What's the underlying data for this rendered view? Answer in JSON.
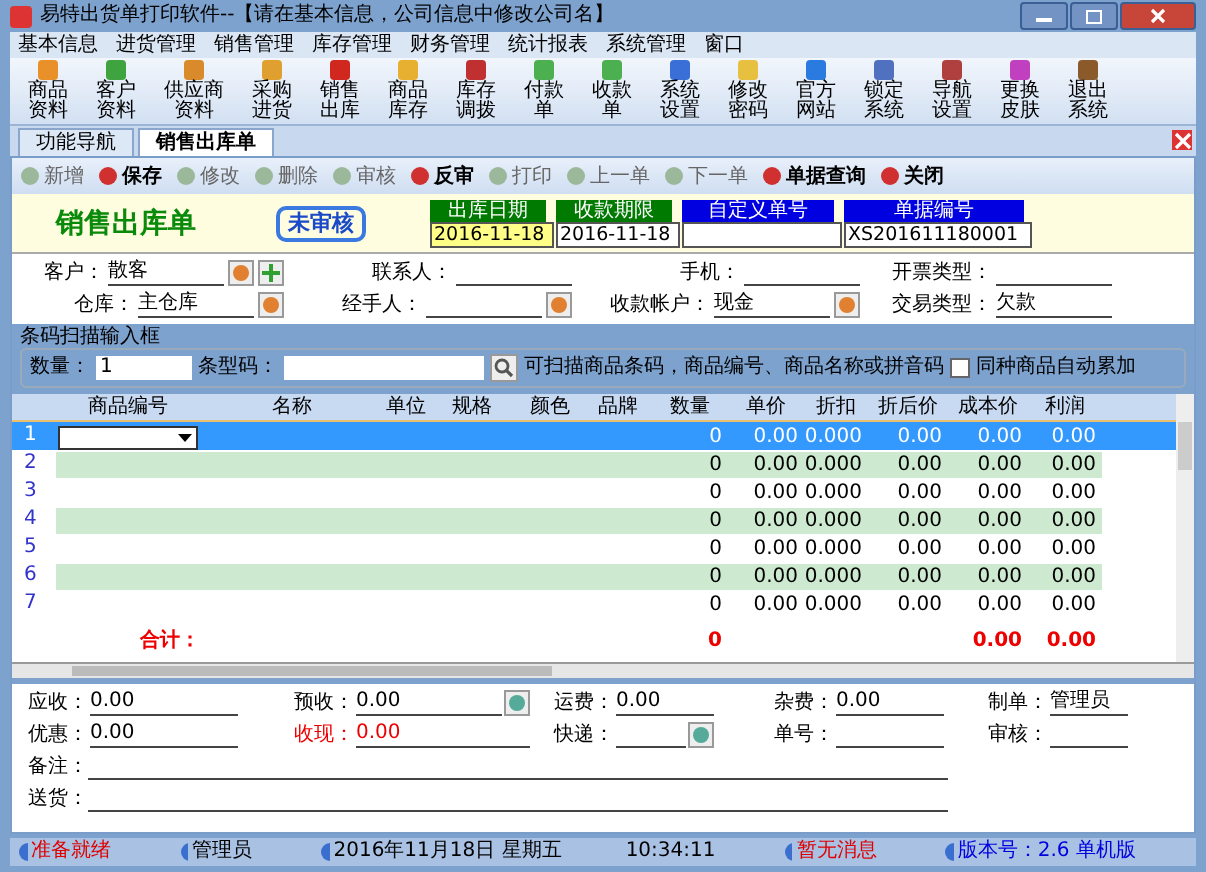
{
  "window": {
    "title": "易特出货单打印软件--【请在基本信息，公司信息中修改公司名】"
  },
  "menu": [
    "基本信息",
    "进货管理",
    "销售管理",
    "库存管理",
    "财务管理",
    "统计报表",
    "系统管理",
    "窗口"
  ],
  "toolbar": [
    {
      "label": "商品资料",
      "color": "#e8902a"
    },
    {
      "label": "客户资料",
      "color": "#3fa33f"
    },
    {
      "label": "供应商资料",
      "color": "#d98a2b"
    },
    {
      "label": "采购进货",
      "color": "#e0a030"
    },
    {
      "label": "销售出库",
      "color": "#d0281e"
    },
    {
      "label": "商品库存",
      "color": "#e8b030"
    },
    {
      "label": "库存调拨",
      "color": "#c03030"
    },
    {
      "label": "付款单",
      "color": "#4caf50"
    },
    {
      "label": "收款单",
      "color": "#4caf50"
    },
    {
      "label": "系统设置",
      "color": "#3a6fd8"
    },
    {
      "label": "修改密码",
      "color": "#e8c040"
    },
    {
      "label": "官方网站",
      "color": "#2a7ae0"
    },
    {
      "label": "锁定系统",
      "color": "#5070c0"
    },
    {
      "label": "导航设置",
      "color": "#b04040"
    },
    {
      "label": "更换皮肤",
      "color": "#c040c0"
    },
    {
      "label": "退出系统",
      "color": "#8a5a2a"
    }
  ],
  "tabs": [
    {
      "label": "功能导航",
      "selected": false
    },
    {
      "label": "销售出库单",
      "selected": true
    }
  ],
  "actions": [
    {
      "label": "新增",
      "disabled": true
    },
    {
      "label": "保存",
      "disabled": false
    },
    {
      "label": "修改",
      "disabled": true
    },
    {
      "label": "删除",
      "disabled": true
    },
    {
      "label": "审核",
      "disabled": true
    },
    {
      "label": "反审",
      "disabled": false
    },
    {
      "label": "打印",
      "disabled": true
    },
    {
      "label": "上一单",
      "disabled": true
    },
    {
      "label": "下一单",
      "disabled": true
    },
    {
      "label": "单据查询",
      "disabled": false
    },
    {
      "label": "关闭",
      "disabled": false
    }
  ],
  "form": {
    "title": "销售出库单",
    "stamp": "未审核",
    "header_fields": [
      {
        "label": "出库日期",
        "value": "2016-11-18",
        "color": "#007a00",
        "highlighted": true
      },
      {
        "label": "收款期限",
        "value": "2016-11-18",
        "color": "#007a00",
        "highlighted": false
      },
      {
        "label": "自定义单号",
        "color": "#0000e0",
        "highlighted": false
      },
      {
        "label": "单据编号",
        "value": "XS201611180001",
        "color": "#0000e0",
        "highlighted": false
      }
    ],
    "fields": [
      [
        {
          "label": "客户：",
          "value": "散客",
          "picker": true,
          "add": true
        },
        {
          "label": "联系人：",
          "picker": false,
          "add": false
        },
        {
          "label": "手机：",
          "picker": false,
          "add": false
        },
        {
          "label": "开票类型：",
          "picker": false,
          "add": false
        }
      ],
      [
        {
          "label": "仓库：",
          "value": "主仓库",
          "picker": true,
          "add": false
        },
        {
          "label": "经手人：",
          "picker": true,
          "add": false
        },
        {
          "label": "收款帐户：",
          "value": "现金",
          "picker": true,
          "add": false
        },
        {
          "label": "交易类型：",
          "value": "欠款",
          "picker": false,
          "add": false
        }
      ]
    ]
  },
  "barcode": {
    "legend": "条码扫描输入框",
    "qty_label": "数量：",
    "qty_value": "1",
    "code_label": "条型码：",
    "hint": "可扫描商品条码，商品编号、商品名称或拼音码",
    "checkbox": {
      "label": "同种商品自动累加",
      "checked": false
    }
  },
  "grid": {
    "columns": [
      "商品编号",
      "名称",
      "单位",
      "规格",
      "颜色",
      "品牌",
      "数量",
      "单价",
      "折扣",
      "折后价",
      "成本价",
      "利润"
    ],
    "rows": [
      {
        "no": "1",
        "selected": true,
        "cells": [
          "",
          "",
          "",
          "",
          "",
          "",
          "0",
          "0.00",
          "0.000",
          "0.00",
          "0.00",
          "0.00"
        ]
      },
      {
        "no": "2",
        "selected": false,
        "cells": [
          "",
          "",
          "",
          "",
          "",
          "",
          "0",
          "0.00",
          "0.000",
          "0.00",
          "0.00",
          "0.00"
        ]
      },
      {
        "no": "3",
        "selected": false,
        "cells": [
          "",
          "",
          "",
          "",
          "",
          "",
          "0",
          "0.00",
          "0.000",
          "0.00",
          "0.00",
          "0.00"
        ]
      },
      {
        "no": "4",
        "selected": false,
        "cells": [
          "",
          "",
          "",
          "",
          "",
          "",
          "0",
          "0.00",
          "0.000",
          "0.00",
          "0.00",
          "0.00"
        ]
      },
      {
        "no": "5",
        "selected": false,
        "cells": [
          "",
          "",
          "",
          "",
          "",
          "",
          "0",
          "0.00",
          "0.000",
          "0.00",
          "0.00",
          "0.00"
        ]
      },
      {
        "no": "6",
        "selected": false,
        "cells": [
          "",
          "",
          "",
          "",
          "",
          "",
          "0",
          "0.00",
          "0.000",
          "0.00",
          "0.00",
          "0.00"
        ]
      },
      {
        "no": "7",
        "selected": false,
        "cells": [
          "",
          "",
          "",
          "",
          "",
          "",
          "0",
          "0.00",
          "0.000",
          "0.00",
          "0.00",
          "0.00"
        ]
      }
    ],
    "total": {
      "label": "合计：",
      "quantity": "0",
      "cost": "0.00",
      "profit": "0.00"
    }
  },
  "footer": {
    "rows": [
      [
        {
          "label": "应收：",
          "value": "0.00",
          "button": false,
          "red": false
        },
        {
          "label": "预收：",
          "value": "0.00",
          "button": true,
          "red": false
        },
        {
          "label": "运费：",
          "value": "0.00",
          "button": false,
          "red": false
        },
        {
          "label": "杂费：",
          "value": "0.00",
          "button": false,
          "red": false
        },
        {
          "label": "制单：",
          "value": "管理员",
          "button": false,
          "red": false
        }
      ],
      [
        {
          "label": "优惠：",
          "value": "0.00",
          "button": false,
          "red": false
        },
        {
          "label": "收现：",
          "value": "0.00",
          "button": false,
          "red": true
        },
        {
          "label": "快递：",
          "button": true,
          "red": false
        },
        {
          "label": "单号：",
          "button": false,
          "red": false
        },
        {
          "label": "审核：",
          "button": false,
          "red": false
        }
      ]
    ],
    "notes": [
      {
        "label": "备注："
      },
      {
        "label": "送货："
      }
    ]
  },
  "status_bar": [
    {
      "text": "准备就绪",
      "color": "#e00000"
    },
    {
      "text": "管理员",
      "color": "#000000"
    },
    {
      "text": "2016年11月18日 星期五",
      "color": "#000000"
    },
    {
      "text": "10:34:11",
      "color": "#000000"
    },
    {
      "text": "暂无消息",
      "color": "#e00000"
    },
    {
      "text": "版本号：2.6 单机版",
      "color": "#0000e0"
    }
  ]
}
